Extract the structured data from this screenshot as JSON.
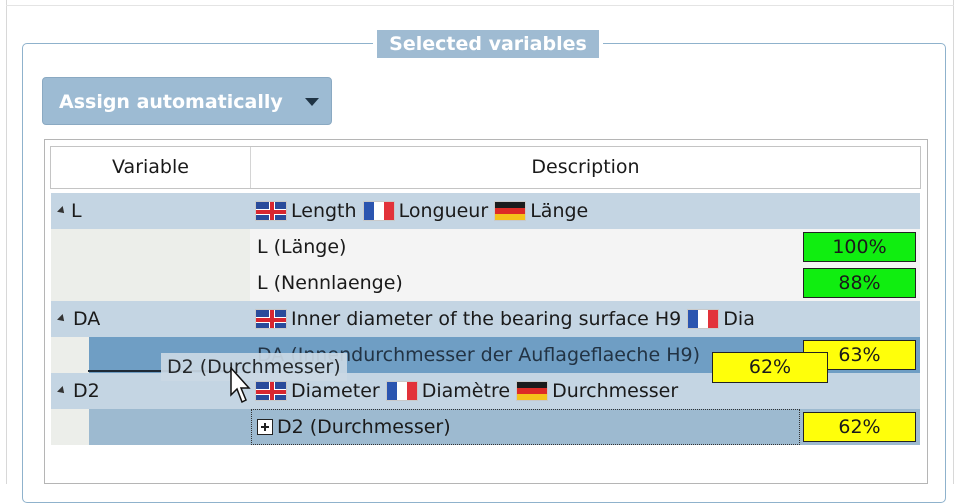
{
  "group": {
    "title": "Selected variables"
  },
  "assign_button": {
    "label": "Assign automatically",
    "icon": "chevron-down-icon"
  },
  "table": {
    "columns": [
      "Variable",
      "Description"
    ],
    "rows": [
      {
        "kind": "group",
        "variable": "L",
        "descriptions": [
          {
            "flag": "uk-flag-icon",
            "text": "Length"
          },
          {
            "flag": "fr-flag-icon",
            "text": "Longueur"
          },
          {
            "flag": "de-flag-icon",
            "text": "Länge"
          }
        ]
      },
      {
        "kind": "child",
        "description": "L (Länge)",
        "percent": "100%",
        "percent_color": "#10ee10"
      },
      {
        "kind": "child",
        "description": "L (Nennlaenge)",
        "percent": "88%",
        "percent_color": "#10ee10"
      },
      {
        "kind": "group",
        "variable": "DA",
        "descriptions": [
          {
            "flag": "uk-flag-icon",
            "text": "Inner diameter of the bearing surface H9"
          },
          {
            "flag": "fr-flag-icon",
            "text": "Dia"
          }
        ]
      },
      {
        "kind": "child",
        "description": "DA (Innendurchmesser der Auflageflaeche H9)",
        "percent": "63%",
        "percent_color": "#ffff0a"
      },
      {
        "kind": "group",
        "variable": "D2",
        "descriptions": [
          {
            "flag": "uk-flag-icon",
            "text": "Diameter"
          },
          {
            "flag": "fr-flag-icon",
            "text": "Diamètre"
          },
          {
            "flag": "de-flag-icon",
            "text": "Durchmesser"
          }
        ]
      },
      {
        "kind": "child",
        "description": "D2 (Durchmesser)",
        "percent": "62%",
        "percent_color": "#ffff0a"
      }
    ]
  },
  "drag": {
    "label": "D2 (Durchmesser)",
    "percent": "62%"
  }
}
